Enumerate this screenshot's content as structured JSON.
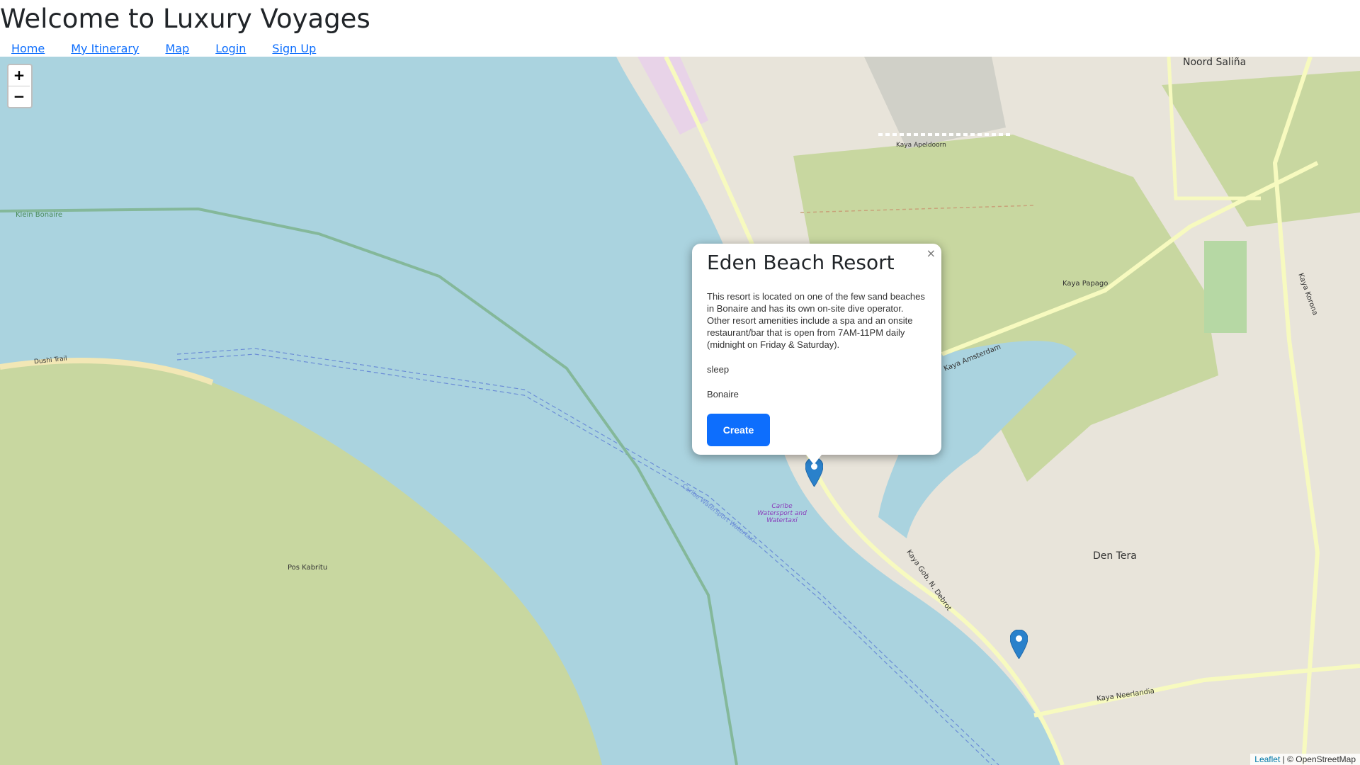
{
  "page": {
    "title": "Welcome to Luxury Voyages"
  },
  "nav": {
    "items": [
      {
        "label": "Home"
      },
      {
        "label": "My Itinerary"
      },
      {
        "label": "Map"
      },
      {
        "label": "Login"
      },
      {
        "label": "Sign Up"
      }
    ]
  },
  "map": {
    "zoom_in": "+",
    "zoom_out": "−",
    "labels": {
      "noord_salina": "Noord Saliña",
      "den_tera": "Den Tera",
      "klein_bonaire": "Klein Bonaire",
      "pos_kabritu": "Pos Kabritu",
      "dushi_trail": "Dushi Trail",
      "kaya_amsterdam": "Kaya Amsterdam",
      "kaya_neerlandia": "Kaya Neerlandia",
      "kaya_gob_debrot": "Kaya Gob. N. Debrot",
      "kaya_korona": "Kaya Korona",
      "kaya_papago": "Kaya Papago",
      "kaya_apeldoorn": "Kaya Apeldoorn",
      "caribe_label": "Caribe Watersport and Watertaxi",
      "waterway_label": "Caribe Watersport Watertaxi"
    },
    "attribution": {
      "leaflet": "Leaflet",
      "rest": "| © OpenStreetMap"
    }
  },
  "popup": {
    "title": "Eden Beach Resort",
    "description": "This resort is located on one of the few sand beaches in Bonaire and has its own on-site dive operator. Other resort amenities include a spa and an onsite restaurant/bar that is open from 7AM-11PM daily (midnight on Friday & Saturday).",
    "category": "sleep",
    "location": "Bonaire",
    "button": "Create",
    "close": "×"
  },
  "colors": {
    "water": "#aad3df",
    "land": "#c8d7a0",
    "urban": "#e8e4da",
    "marker": "#2a81cb",
    "button": "#0d6efd"
  }
}
